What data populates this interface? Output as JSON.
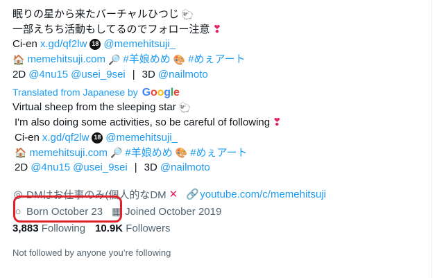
{
  "bio": {
    "line1": "眠りの星から来たバーチャルひつじ",
    "line2": "一部えちち活動もしてるのでフォロー注意",
    "line3_prefix": "Ci-en",
    "line3_link": "x.gd/qf2lw",
    "line3_handle": "@memehitsuji_",
    "line4_link": "memehitsuji.com",
    "line4_tag1": "#羊娘めめ",
    "line4_tag2": "#めぇアート",
    "line5_2d": "2D",
    "line5_u1": "@4nu15",
    "line5_u2": "@usei_9sei",
    "line5_sep": "|",
    "line5_3d": "3D",
    "line5_u3": "@nailmoto"
  },
  "translation": {
    "label": "Translated from Japanese by",
    "google": [
      "G",
      "o",
      "o",
      "g",
      "l",
      "e"
    ]
  },
  "translated_bio": {
    "line1": "Virtual sheep from the sleeping star",
    "line2": "I'm also doing some activities, so be careful of following",
    "line3_prefix": "Ci-en",
    "line3_link": "x.gd/qf2lw",
    "line3_handle": "@memehitsuji_",
    "line4_link": "memehitsuji.com",
    "line4_tag1": "#羊娘めめ",
    "line4_tag2": "#めぇアート",
    "line5_2d": "2D",
    "line5_u1": "@4nu15",
    "line5_u2": "@usei_9sei",
    "line5_sep": "|",
    "line5_3d": "3D",
    "line5_u3": "@nailmoto"
  },
  "meta": {
    "location": "DMはお仕事のみ(個人的なDM",
    "website": "youtube.com/c/memehitsuji",
    "birthday": "Born October 23",
    "joined": "Joined October 2019"
  },
  "follow": {
    "following_count": "3,883",
    "following_label": "Following",
    "followers_count": "10.9K",
    "followers_label": "Followers"
  },
  "not_followed": "Not followed by anyone you’re following",
  "icons": {
    "sheep": "🐑",
    "heart": "❣",
    "age": "18",
    "house": "🏠",
    "magnifier": "🔎",
    "palette": "🎨",
    "location": "◎",
    "link": "🔗",
    "balloon": "○",
    "calendar": "▦",
    "cross": "✕"
  },
  "colors": {
    "link": "#1d9bf0",
    "secondary": "#536471",
    "highlight": "#e0202a"
  }
}
